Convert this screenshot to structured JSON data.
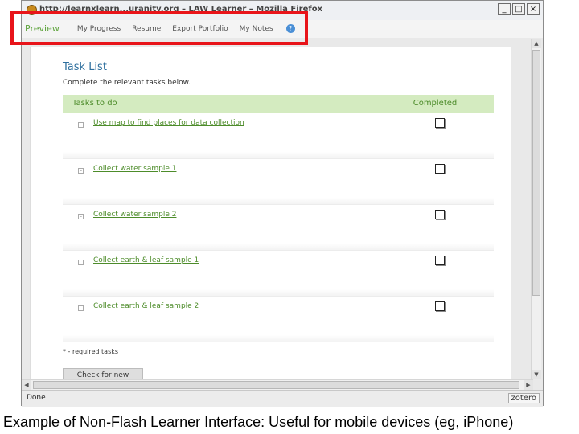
{
  "window": {
    "title": "http://learnxlearn...uranity.org – LAW Learner – Mozilla Firefox",
    "buttons": {
      "minimize": "_",
      "maximize": "□",
      "close": "×"
    }
  },
  "appbar": {
    "preview": "Preview",
    "nav": [
      "My Progress",
      "Resume",
      "Export Portfolio",
      "My Notes"
    ],
    "help": "?"
  },
  "page": {
    "title": "Task List",
    "instructions": "Complete the relevant tasks below.",
    "columns": {
      "tasks": "Tasks to do",
      "completed": "Completed"
    },
    "tasks": [
      {
        "label": "Use map to find places for data collection",
        "required": true,
        "completed": false
      },
      {
        "label": "Collect water sample 1",
        "required": true,
        "completed": false
      },
      {
        "label": "Collect water sample 2",
        "required": true,
        "completed": false
      },
      {
        "label": "Collect earth & leaf sample 1",
        "required": false,
        "completed": false
      },
      {
        "label": "Collect earth & leaf sample 2",
        "required": false,
        "completed": false
      }
    ],
    "footnote": "* - required tasks",
    "check_button": "Check for new"
  },
  "statusbar": {
    "status": "Done",
    "zotero": "zotero"
  },
  "caption": "Example of Non-Flash Learner Interface: Useful for mobile devices (eg, iPhone)",
  "colors": {
    "accent_green": "#5da33b",
    "header_green": "#d4ebc0",
    "title_blue": "#2e6f9e",
    "highlight_red": "#e8141a"
  }
}
